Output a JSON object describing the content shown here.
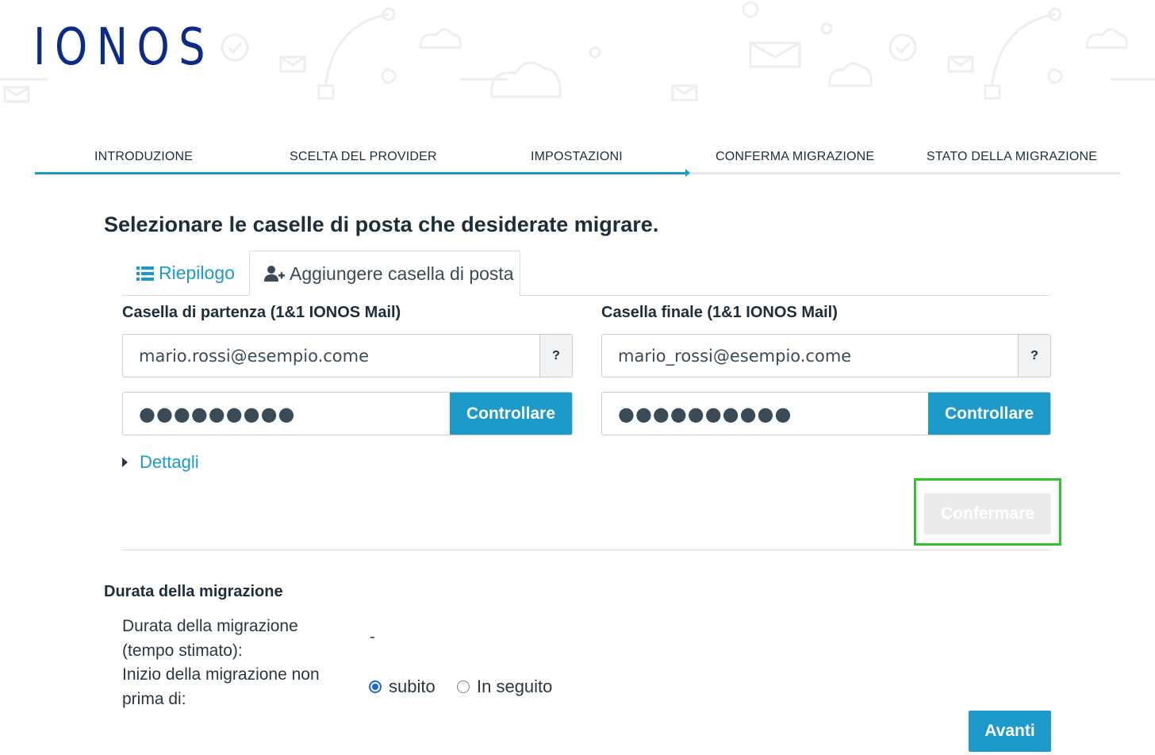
{
  "brand": {
    "logo_text": "IONOS",
    "logo_color": "#0b2a8a",
    "accent": "#1c9ac9"
  },
  "steps": [
    {
      "label": "INTRODUZIONE",
      "state": "done"
    },
    {
      "label": "SCELTA DEL PROVIDER",
      "state": "done"
    },
    {
      "label": "IMPOSTAZIONI",
      "state": "current"
    },
    {
      "label": "CONFERMA MIGRAZIONE",
      "state": "todo"
    },
    {
      "label": "STATO DELLA MIGRAZIONE",
      "state": "todo"
    }
  ],
  "progress_fraction": 0.6,
  "page": {
    "title": "Selezionare le caselle di posta che desiderate migrare."
  },
  "tabs": {
    "overview": {
      "label": "Riepilogo",
      "icon": "list-icon"
    },
    "add": {
      "label": "Aggiungere casella di posta",
      "icon": "user-plus-icon",
      "active": true
    }
  },
  "source": {
    "label": "Casella di partenza (1&1 IONOS Mail)",
    "email_value": "mario.rossi@esempio.come",
    "password_value": "●●●●●●●●●",
    "help_label": "?",
    "check_label": "Controllare"
  },
  "target": {
    "label": "Casella finale (1&1 IONOS Mail)",
    "email_value": "mario_rossi@esempio.come",
    "password_value": "●●●●●●●●●●",
    "help_label": "?",
    "check_label": "Controllare"
  },
  "details": {
    "label": "Dettagli"
  },
  "confirm": {
    "label": "Confermare",
    "disabled": true,
    "highlight_color": "#2fc42f"
  },
  "duration": {
    "heading": "Durata della migrazione",
    "estimate_label": "Durata della migrazione (tempo stimato):",
    "estimate_value": "-",
    "start_label": "Inizio della migrazione non prima di:",
    "options": [
      {
        "label": "subito",
        "selected": true
      },
      {
        "label": "In seguito",
        "selected": false
      }
    ]
  },
  "next": {
    "label": "Avanti"
  }
}
